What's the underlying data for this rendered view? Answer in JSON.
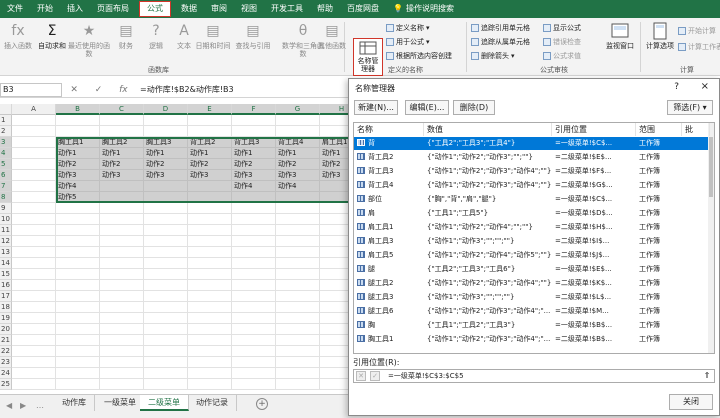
{
  "menu": [
    "文件",
    "开始",
    "插入",
    "页面布局",
    "公式",
    "数据",
    "审阅",
    "视图",
    "开发工具",
    "帮助",
    "百度网盘"
  ],
  "active_menu": "公式",
  "tell_me": "操作说明搜索",
  "ribbon": {
    "buttons": [
      {
        "label": "插入函数",
        "icon": "fx"
      },
      {
        "label": "自动求和",
        "icon": "Σ"
      },
      {
        "label": "最近使用的函数",
        "icon": "★"
      },
      {
        "label": "财务",
        "icon": "fin"
      },
      {
        "label": "逻辑",
        "icon": "?"
      },
      {
        "label": "文本",
        "icon": "A"
      },
      {
        "label": "日期和时间",
        "icon": "cal"
      },
      {
        "label": "查找与引用",
        "icon": "lookup"
      },
      {
        "label": "数学和三角函数",
        "icon": "θ"
      },
      {
        "label": "其他函数",
        "icon": "more"
      }
    ],
    "group_functions": "函数库",
    "name_manager_label": "名称管理器",
    "define_name": "定义名称",
    "use_in_formula": "用于公式",
    "create_from_selection": "根据所选内容创建",
    "group_defined": "定义的名称",
    "trace_precedents": "追踪引用单元格",
    "trace_dependents": "追踪从属单元格",
    "remove_arrows": "删除箭头",
    "show_formulas": "显示公式",
    "error_check": "错误检查",
    "evaluate": "公式求值",
    "group_audit": "公式审核",
    "watch_window": "监视窗口",
    "calc_options": "计算选项",
    "calc_now": "开始计算",
    "calc_sheet": "计算工作表",
    "group_calc": "计算"
  },
  "formula_bar": {
    "name_box": "B3",
    "formula": "=动作库!$B2&动作库!B3"
  },
  "grid": {
    "columns": [
      "A",
      "B",
      "C",
      "D",
      "E",
      "F",
      "G",
      "H"
    ],
    "rows": [
      "1",
      "2",
      "3",
      "4",
      "5",
      "6",
      "7",
      "8",
      "9",
      "10",
      "11",
      "12",
      "13",
      "14",
      "15",
      "16",
      "17",
      "18",
      "19",
      "20",
      "21",
      "22",
      "23",
      "24",
      "25"
    ],
    "headers": [
      "胸工具1",
      "胸工具2",
      "胸工具3",
      "背工具2",
      "背工具3",
      "背工具4",
      "肩工具1"
    ],
    "data": [
      [
        "动作1",
        "动作1",
        "动作1",
        "动作1",
        "动作1",
        "动作1",
        "动作1"
      ],
      [
        "动作2",
        "动作2",
        "动作2",
        "动作2",
        "动作2",
        "动作2",
        "动作2"
      ],
      [
        "动作3",
        "动作3",
        "动作3",
        "动作3",
        "动作3",
        "动作3",
        "动作3"
      ],
      [
        "动作4",
        "",
        "",
        "",
        "动作4",
        "动作4",
        ""
      ],
      [
        "动作5",
        "",
        "",
        "",
        "",
        "",
        ""
      ]
    ]
  },
  "sheet_tabs": [
    "动作库",
    "一级菜单",
    "二级菜单",
    "动作记录"
  ],
  "active_tab": "二级菜单",
  "dialog": {
    "title": "名称管理器",
    "help": "?",
    "close_x": "×",
    "new_btn": "新建(N)...",
    "edit_btn": "编辑(E)...",
    "delete_btn": "删除(D)",
    "filter_btn": "筛选(F) ▾",
    "columns": [
      "名称",
      "数值",
      "引用位置",
      "范围",
      "批"
    ],
    "rows": [
      {
        "name": "背",
        "value": "{\"工具2\";\"工具3\";\"工具4\"}",
        "ref": "=一级菜单!$C$...",
        "scope": "工作簿"
      },
      {
        "name": "背工具2",
        "value": "{\"动作1\";\"动作2\";\"动作3\";\"\";\"\"}",
        "ref": "=二级菜单!$E$...",
        "scope": "工作簿"
      },
      {
        "name": "背工具3",
        "value": "{\"动作1\";\"动作2\";\"动作3\";\"动作4\";\"\"}",
        "ref": "=二级菜单!$F$...",
        "scope": "工作簿"
      },
      {
        "name": "背工具4",
        "value": "{\"动作1\";\"动作2\";\"动作3\";\"动作4\";\"\"}",
        "ref": "=二级菜单!$G$...",
        "scope": "工作簿"
      },
      {
        "name": "部位",
        "value": "{\"胸\",\"背\",\"肩\",\"腿\"}",
        "ref": "=一级菜单!$C$...",
        "scope": "工作簿"
      },
      {
        "name": "肩",
        "value": "{\"工具1\";\"工具5\"}",
        "ref": "=一级菜单!$D$...",
        "scope": "工作簿"
      },
      {
        "name": "肩工具1",
        "value": "{\"动作1\";\"动作2\";\"动作4\";\"\";\"\"}",
        "ref": "=二级菜单!$H$...",
        "scope": "工作簿"
      },
      {
        "name": "肩工具3",
        "value": "{\"动作1\";\"动作3\";\"\";\"\";\"\"}",
        "ref": "=二级菜单!$I$...",
        "scope": "工作簿"
      },
      {
        "name": "肩工具5",
        "value": "{\"动作1\";\"动作2\";\"动作4\";\"动作5\";\"\"}",
        "ref": "=二级菜单!$J$...",
        "scope": "工作簿"
      },
      {
        "name": "腿",
        "value": "{\"工具2\";\"工具3\";\"工具6\"}",
        "ref": "=一级菜单!$E$...",
        "scope": "工作簿"
      },
      {
        "name": "腿工具2",
        "value": "{\"动作1\";\"动作2\";\"动作3\";\"动作4\";\"\"}",
        "ref": "=二级菜单!$K$...",
        "scope": "工作簿"
      },
      {
        "name": "腿工具3",
        "value": "{\"动作1\";\"动作3\";\"\";\"\";\"\"}",
        "ref": "=二级菜单!$L$...",
        "scope": "工作簿"
      },
      {
        "name": "腿工具6",
        "value": "{\"动作1\";\"动作2\";\"动作3\";\"动作4\";\"...",
        "ref": "=二级菜单!$M...",
        "scope": "工作簿"
      },
      {
        "name": "胸",
        "value": "{\"工具1\";\"工具2\";\"工具3\"}",
        "ref": "=一级菜单!$B$...",
        "scope": "工作簿"
      },
      {
        "name": "胸工具1",
        "value": "{\"动作1\";\"动作2\";\"动作3\";\"动作4\";\"...",
        "ref": "=二级菜单!$B$...",
        "scope": "工作簿"
      }
    ],
    "ref_label": "引用位置(R):",
    "ref_value": "=一级菜单!$C$3:$C$5",
    "close_btn": "关闭"
  },
  "colors": {
    "excel_green": "#217346",
    "selection_blue": "#0078d7",
    "highlight_red": "#d0362a"
  }
}
